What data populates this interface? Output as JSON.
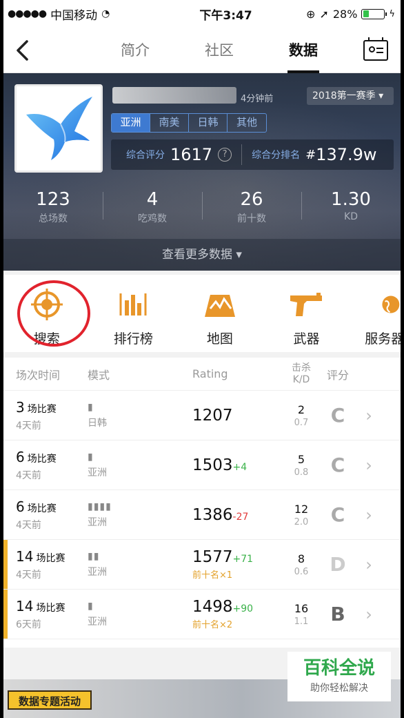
{
  "status_bar": {
    "signal": "●●●●●",
    "carrier": "中国移动",
    "wifi": "wifi-icon",
    "time": "下午3:47",
    "battery_pct": "28%"
  },
  "nav": {
    "back": "‹",
    "tabs": [
      {
        "label": "简介"
      },
      {
        "label": "社区"
      },
      {
        "label": "数据"
      }
    ],
    "active_tab": "数据"
  },
  "profile": {
    "updated": "4分钟前",
    "season": "2018第一赛季 ▾",
    "regions": [
      "亚洲",
      "南美",
      "日韩",
      "其他"
    ],
    "active_region": "亚洲",
    "score_label": "综合评分",
    "score": "1617",
    "rank_label": "综合分排名",
    "rank_hash": "#",
    "rank": "137.9w",
    "stats": [
      {
        "num": "123",
        "label": "总场数"
      },
      {
        "num": "4",
        "label": "吃鸡数"
      },
      {
        "num": "26",
        "label": "前十数"
      },
      {
        "num": "1.30",
        "label": "KD"
      }
    ],
    "more": "查看更多数据 ▾"
  },
  "shortcuts": [
    {
      "label": "搜索",
      "icon": "crosshair-icon"
    },
    {
      "label": "排行榜",
      "icon": "bar-chart-icon"
    },
    {
      "label": "地图",
      "icon": "map-icon"
    },
    {
      "label": "武器",
      "icon": "pistol-icon"
    },
    {
      "label": "服务器",
      "icon": "globe-icon"
    }
  ],
  "table": {
    "headers": {
      "time": "场次时间",
      "mode": "模式",
      "rating": "Rating",
      "kills_line1": "击杀",
      "kills_line2": "K/D",
      "grade": "评分"
    },
    "rows": [
      {
        "games": "3",
        "games_unit": "场比赛",
        "ago": "4天前",
        "mode_icon": "🚶",
        "mode": "日韩",
        "rating": "1207",
        "delta": "",
        "top10": "",
        "kills": "2",
        "kd": "0.7",
        "grade": "C"
      },
      {
        "games": "6",
        "games_unit": "场比赛",
        "ago": "4天前",
        "mode_icon": "🚶",
        "mode": "亚洲",
        "rating": "1503",
        "delta": "+4",
        "top10": "",
        "kills": "5",
        "kd": "0.8",
        "grade": "C"
      },
      {
        "games": "6",
        "games_unit": "场比赛",
        "ago": "4天前",
        "mode_icon": "🚶🚶🚶🚶",
        "mode": "亚洲",
        "rating": "1386",
        "delta": "-27",
        "top10": "",
        "kills": "12",
        "kd": "2.0",
        "grade": "C"
      },
      {
        "games": "14",
        "games_unit": "场比赛",
        "ago": "4天前",
        "mode_icon": "🚶🚶",
        "mode": "亚洲",
        "rating": "1577",
        "delta": "+71",
        "top10": "前十名×1",
        "kills": "8",
        "kd": "0.6",
        "grade": "D"
      },
      {
        "games": "14",
        "games_unit": "场比赛",
        "ago": "6天前",
        "mode_icon": "🚶",
        "mode": "亚洲",
        "rating": "1498",
        "delta": "+90",
        "top10": "前十名×2",
        "kills": "16",
        "kd": "1.1",
        "grade": "B"
      }
    ]
  },
  "activity_badge": "数据专题活动",
  "watermark": {
    "title": "百科全说",
    "subtitle": "助你轻松解决"
  },
  "colors": {
    "accent_orange": "#e8962a",
    "highlight_red": "#e1232d",
    "region_blue": "#3e7ad1",
    "up_green": "#3bb24a",
    "down_red": "#e23b3b"
  }
}
